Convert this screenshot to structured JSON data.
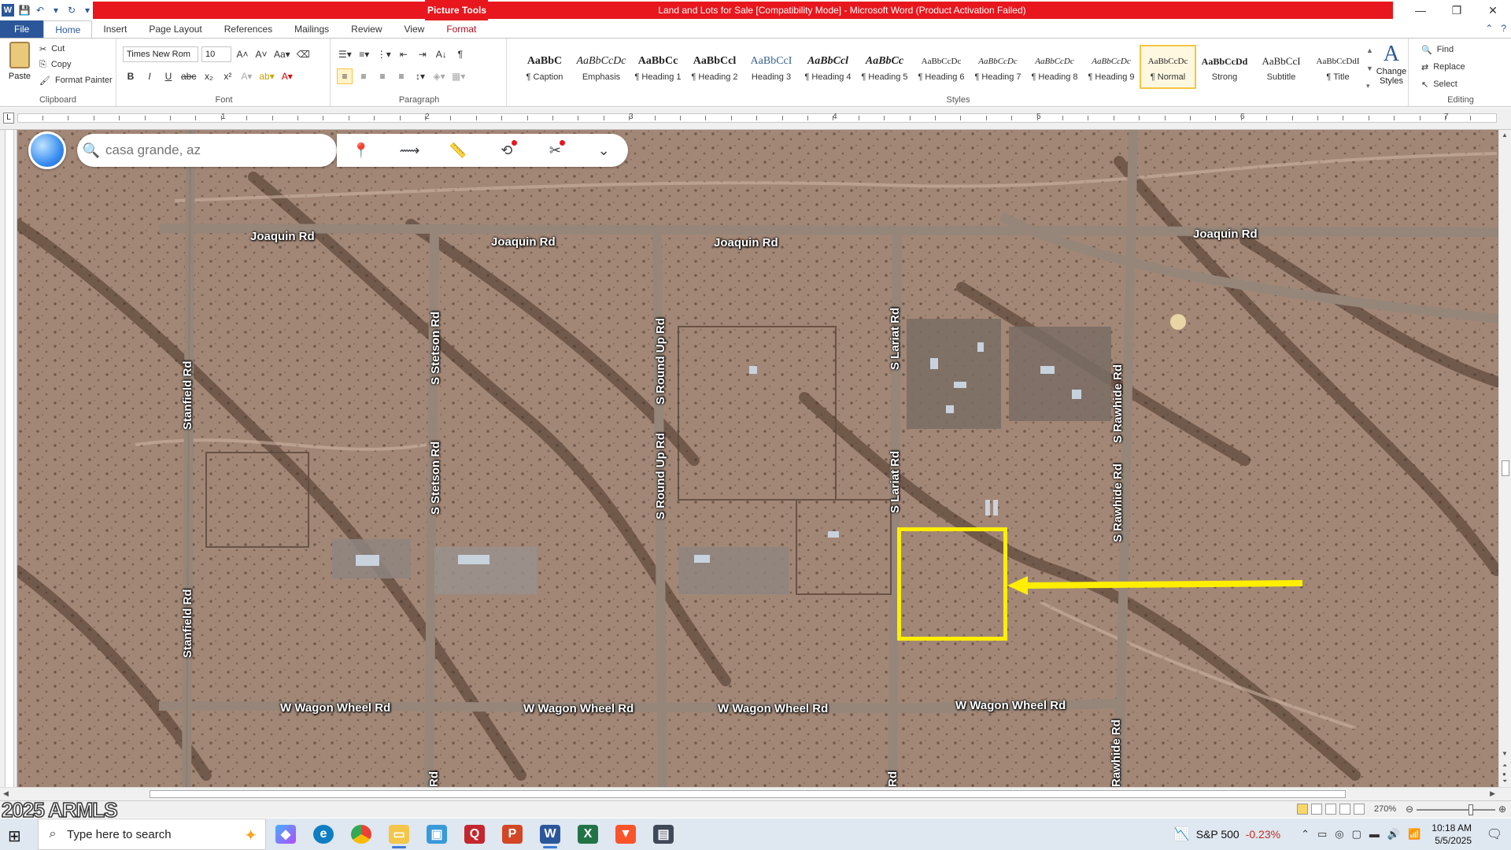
{
  "titlebar": {
    "contextual_tab": "Picture Tools",
    "document_title": "Land and Lots for Sale [Compatibility Mode] - Microsoft Word (Product Activation Failed)",
    "accent_red": "#e8161d"
  },
  "tabs": [
    {
      "label": "File"
    },
    {
      "label": "Home"
    },
    {
      "label": "Insert"
    },
    {
      "label": "Page Layout"
    },
    {
      "label": "References"
    },
    {
      "label": "Mailings"
    },
    {
      "label": "Review"
    },
    {
      "label": "View"
    },
    {
      "label": "Format"
    }
  ],
  "clipboard": {
    "paste": "Paste",
    "cut": "Cut",
    "copy": "Copy",
    "format_painter": "Format Painter",
    "group_label": "Clipboard"
  },
  "font": {
    "font_name": "Times New Rom",
    "font_size": "10",
    "group_label": "Font"
  },
  "paragraph": {
    "group_label": "Paragraph"
  },
  "styles": {
    "group_label": "Styles",
    "items": [
      {
        "sample": "AaBbC",
        "name": "¶ Caption"
      },
      {
        "sample": "AaBbCcDc",
        "name": "Emphasis"
      },
      {
        "sample": "AaBbCc",
        "name": "¶ Heading 1"
      },
      {
        "sample": "AaBbCcl",
        "name": "¶ Heading 2"
      },
      {
        "sample": "AaBbCcI",
        "name": "Heading 3"
      },
      {
        "sample": "AaBbCcl",
        "name": "¶ Heading 4"
      },
      {
        "sample": "AaBbCc",
        "name": "¶ Heading 5"
      },
      {
        "sample": "AaBbCcDc",
        "name": "¶ Heading 6"
      },
      {
        "sample": "AaBbCcDc",
        "name": "¶ Heading 7"
      },
      {
        "sample": "AaBbCcDc",
        "name": "¶ Heading 8"
      },
      {
        "sample": "AaBbCcDc",
        "name": "¶ Heading 9"
      },
      {
        "sample": "AaBbCcDc",
        "name": "¶ Normal"
      },
      {
        "sample": "AaBbCcDd",
        "name": "Strong"
      },
      {
        "sample": "AaBbCcI",
        "name": "Subtitle"
      },
      {
        "sample": "AaBbCcDdI",
        "name": "¶ Title"
      }
    ],
    "selected_index": 11,
    "change_styles": "Change Styles"
  },
  "editing": {
    "group_label": "Editing",
    "find": "Find",
    "replace": "Replace",
    "select": "Select"
  },
  "ruler": {
    "numbers": [
      "1",
      "2",
      "3",
      "4",
      "5",
      "6",
      "7"
    ]
  },
  "map": {
    "search_placeholder": "casa grande, az",
    "highlight_color": "#ffee00",
    "roads": {
      "joaquin_1": "Joaquin Rd",
      "joaquin_2": "Joaquin Rd",
      "joaquin_3": "Joaquin Rd",
      "joaquin_4": "Joaquin Rd",
      "stanfield_1": "Stanfield Rd",
      "stanfield_2": "Stanfield Rd",
      "stetson_1": "S Stetson Rd",
      "stetson_2": "Rd",
      "roundup_1": "S Round Up Rd",
      "roundup_2": "S Round Up Rd",
      "lariat_1": "S Lariat Rd",
      "lariat_2": "S Lariat Rd",
      "lariat_3": "Rd",
      "rawhide_1": "S Rawhide Rd",
      "rawhide_2": "S Rawhide Rd",
      "rawhide_3": "Rawhide Rd",
      "wagon_1": "W Wagon Wheel Rd",
      "wagon_2": "W Wagon Wheel Rd",
      "wagon_3": "W Wagon Wheel Rd",
      "wagon_4": "W Wagon Wheel Rd"
    }
  },
  "statusbar": {
    "watermark": "2025 ARMLS",
    "zoom": "270%"
  },
  "taskbar": {
    "search_placeholder": "Type here to search",
    "stock_name": "S&P 500",
    "stock_change": "-0.23%",
    "time": "10:18 AM",
    "date": "5/5/2025"
  }
}
